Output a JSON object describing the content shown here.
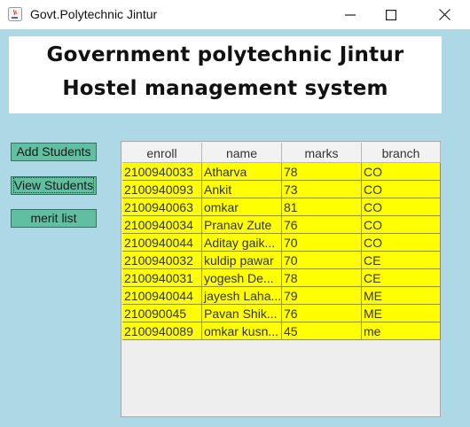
{
  "window": {
    "title": "Govt.Polytechnic Jintur",
    "minimize_label": "—",
    "maximize_label": "☐",
    "close_label": "✕"
  },
  "banner": {
    "line1": "Government polytechnic Jintur",
    "line2": "Hostel management system"
  },
  "buttons": {
    "add_students": "Add Students",
    "view_students": "View Students",
    "merit_list": "merit list"
  },
  "table": {
    "columns": [
      "enroll",
      "name",
      "marks",
      "branch"
    ],
    "rows": [
      [
        "2100940033",
        "Atharva",
        "78",
        "CO"
      ],
      [
        "2100940093",
        "Ankit",
        "73",
        "CO"
      ],
      [
        "2100940063",
        "omkar",
        "81",
        "CO"
      ],
      [
        "2100940034",
        "Pranav Zute",
        "76",
        "CO"
      ],
      [
        "2100940044",
        "Aditay gaik...",
        "70",
        "CO"
      ],
      [
        "2100940032",
        "kuldip pawar",
        "70",
        "CE"
      ],
      [
        "2100940031",
        "yogesh De...",
        "78",
        "CE"
      ],
      [
        "2100940044",
        "jayesh Laha...",
        "79",
        "ME"
      ],
      [
        "210090045",
        "Pavan Shik...",
        "76",
        "ME"
      ],
      [
        "2100940089",
        "omkar kusn...",
        "45",
        "me"
      ]
    ]
  },
  "colors": {
    "content_bg": "#add8e6",
    "button_bg": "#5fbfa0",
    "row_bg": "#ffff00"
  }
}
